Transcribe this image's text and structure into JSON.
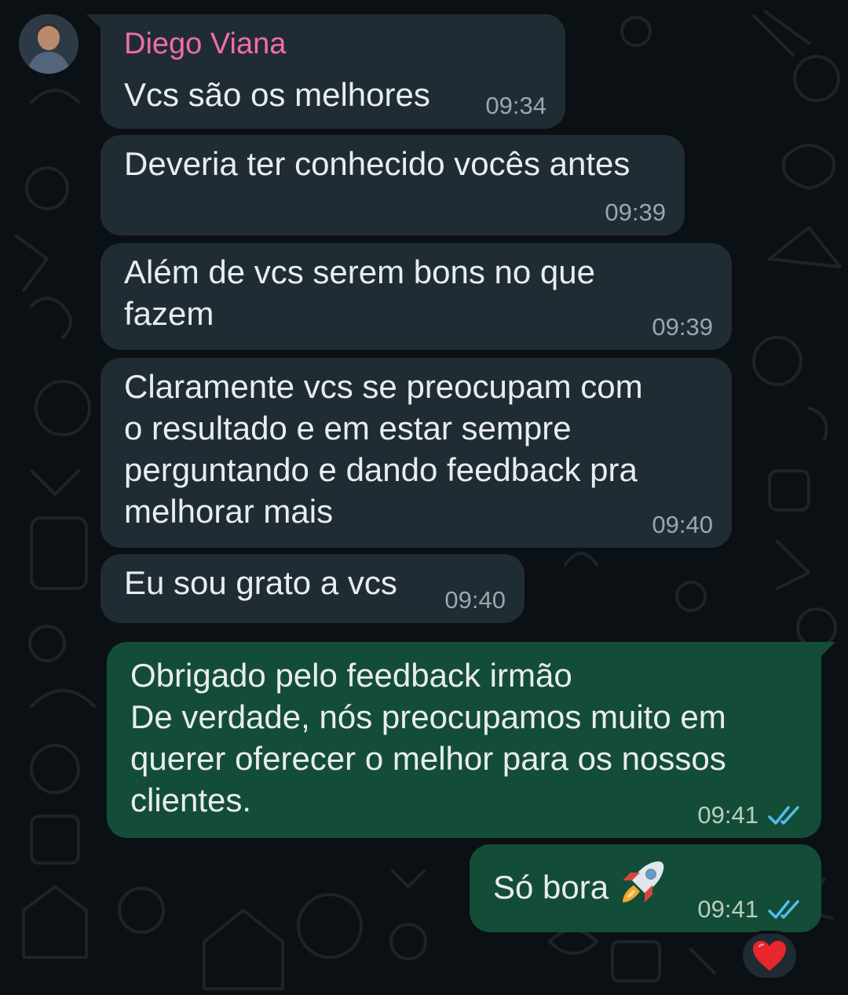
{
  "contact": {
    "name": "Diego Viana"
  },
  "messages": [
    {
      "id": "m1",
      "direction": "incoming",
      "text": "Vcs são os melhores",
      "time": "09:34"
    },
    {
      "id": "m2",
      "direction": "incoming",
      "text": "Deveria ter conhecido vocês antes",
      "time": "09:39"
    },
    {
      "id": "m3",
      "direction": "incoming",
      "text": "Além de vcs serem bons no que\nfazem",
      "time": "09:39"
    },
    {
      "id": "m4",
      "direction": "incoming",
      "text": "Claramente vcs se preocupam com\no resultado e em estar sempre\nperguntando e dando feedback pra\nmelhorar mais",
      "time": "09:40"
    },
    {
      "id": "m5",
      "direction": "incoming",
      "text": "Eu sou grato a vcs",
      "time": "09:40"
    },
    {
      "id": "m6",
      "direction": "outgoing",
      "text": "Obrigado pelo feedback irmão\nDe verdade, nós preocupamos muito em\nquerer oferecer o melhor para os nossos\nclientes.",
      "time": "09:41",
      "status": "read"
    },
    {
      "id": "m7",
      "direction": "outgoing",
      "text": "Só bora",
      "emoji_icon": "rocket-icon",
      "time": "09:41",
      "status": "read",
      "reaction_icon": "heart-icon"
    }
  ],
  "theme": {
    "background": "#0b1014",
    "incoming_bubble": "#202c33",
    "outgoing_bubble": "#144d37",
    "sender_name_color": "#f06bb0",
    "read_tick_color": "#53bdeb"
  }
}
